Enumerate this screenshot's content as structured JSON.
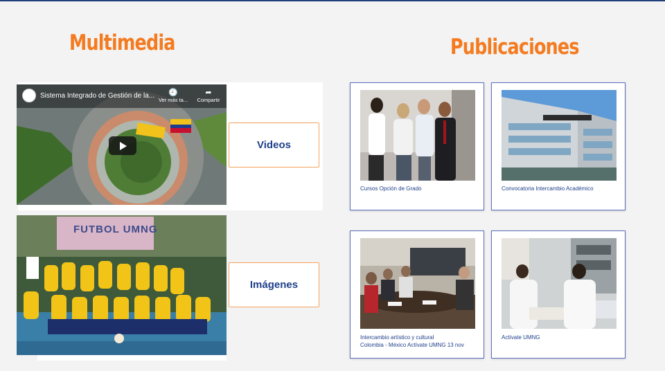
{
  "multimedia": {
    "title": "Multimedia",
    "video": {
      "title": "Sistema Integrado de Gestión de la...",
      "watch_later": "Ver más ta...",
      "share": "Compartir"
    },
    "videos_button": "Videos",
    "images_button": "Imágenes",
    "banner_text": "FUTBOL UMNG"
  },
  "publicaciones": {
    "title": "Publicaciones",
    "cards": [
      {
        "caption": "Cursos Opción de Grado"
      },
      {
        "caption": "Convocatoria Intercambio Académico"
      },
      {
        "caption_line1": "Intercambio artístico y cultural",
        "caption_line2": "Colombia - México Actívate UMNG 13 nov"
      },
      {
        "caption": "Actívate UMNG"
      }
    ]
  },
  "colors": {
    "accent": "#f47b20",
    "brand": "#1f3f8a",
    "card_border": "#5a6fbf"
  }
}
